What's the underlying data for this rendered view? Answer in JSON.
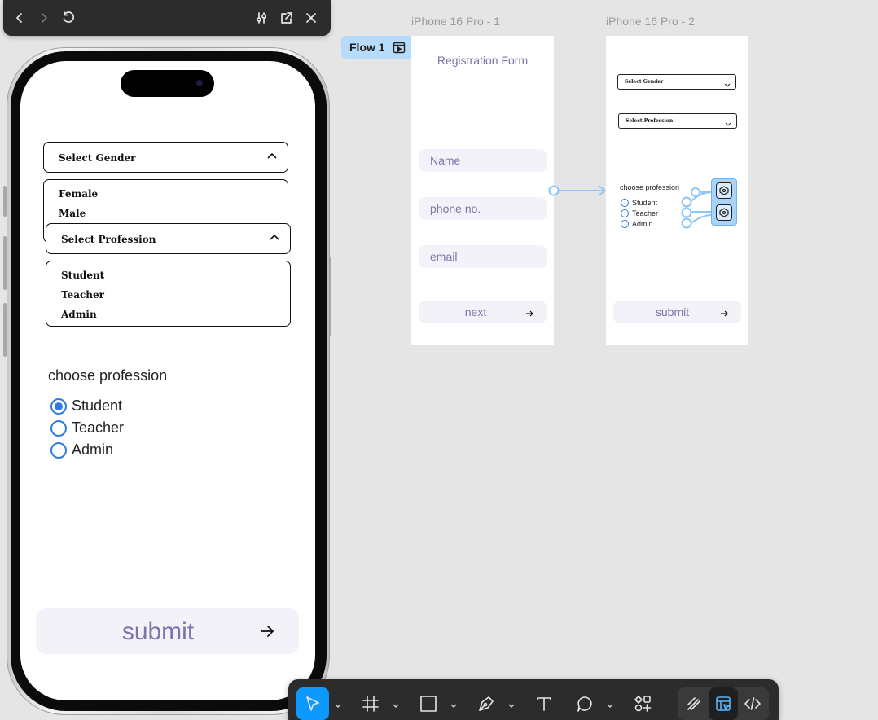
{
  "preview_toolbar": {
    "back_icon": "chevron-left-icon",
    "forward_icon": "chevron-right-icon",
    "restart_icon": "restart-icon",
    "settings_icon": "sliders-icon",
    "open_icon": "external-link-icon",
    "close_icon": "close-icon"
  },
  "phone": {
    "gender_dropdown": {
      "label": "Select Gender",
      "options": [
        "Female",
        "Male"
      ]
    },
    "profession_dropdown": {
      "label": "Select Profession",
      "options": [
        "Student",
        "Teacher",
        "Admin"
      ]
    },
    "radio_group": {
      "title": "choose profession",
      "options": [
        {
          "label": "Student",
          "checked": true
        },
        {
          "label": "Teacher",
          "checked": false
        },
        {
          "label": "Admin",
          "checked": false
        }
      ]
    },
    "submit_label": "submit",
    "accent_color": "#2e7be0",
    "button_text_color": "#7c74ad"
  },
  "canvas": {
    "flow_label": "Flow 1",
    "frame1": {
      "title": "iPhone 16 Pro - 1",
      "heading": "Registration Form",
      "fields": [
        "Name",
        "phone no.",
        "email"
      ],
      "button": "next"
    },
    "frame2": {
      "title": "iPhone 16 Pro - 2",
      "gender_label": "Select Gender",
      "profession_label": "Select Profession",
      "radio_title": "choose profession",
      "radio_options": [
        "Student",
        "Teacher",
        "Admin"
      ],
      "button": "submit"
    }
  },
  "bottom_toolbar": {
    "tools": [
      "move-tool",
      "frame-tool",
      "rectangle-tool",
      "pen-tool",
      "text-tool",
      "comment-tool",
      "components-tool"
    ],
    "modes": [
      "draw-mode",
      "design-mode",
      "dev-mode"
    ],
    "active_tool": "move-tool",
    "active_color": "#0d99ff"
  }
}
